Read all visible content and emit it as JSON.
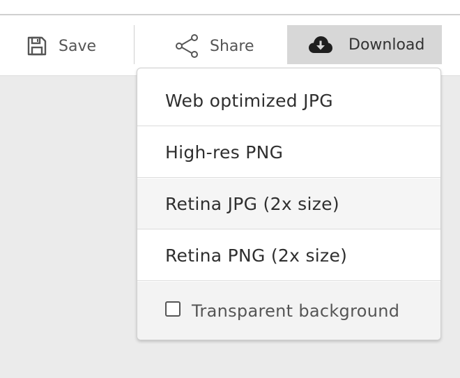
{
  "toolbar": {
    "save_label": "Save",
    "share_label": "Share",
    "download_label": "Download"
  },
  "download_menu": {
    "items": [
      {
        "label": "Web optimized JPG"
      },
      {
        "label": "High-res PNG"
      },
      {
        "label": "Retina JPG (2x size)",
        "hovered": true
      },
      {
        "label": "Retina PNG (2x size)"
      }
    ],
    "transparent_option": {
      "label": "Transparent background",
      "checked": false
    }
  },
  "icons": {
    "save": "floppy-disk-icon",
    "share": "share-nodes-icon",
    "download": "cloud-download-icon"
  },
  "colors": {
    "download_button_bg": "#d7d7d7",
    "hover_item_bg": "#f5f5f5",
    "page_bg": "#ebebeb"
  }
}
